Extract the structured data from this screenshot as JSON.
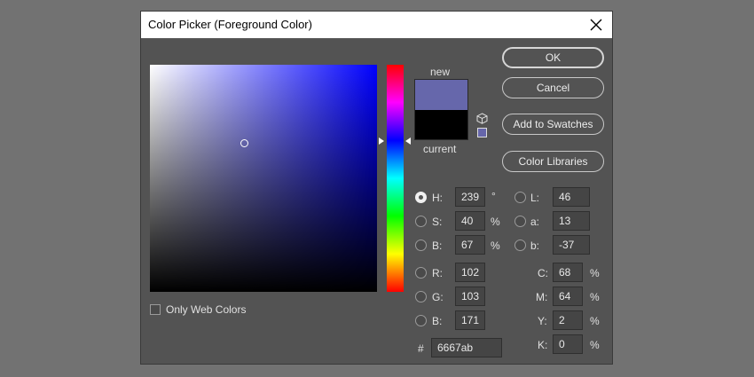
{
  "dialog": {
    "title": "Color Picker (Foreground Color)",
    "close_icon": "close-icon"
  },
  "swatch": {
    "new_label": "new",
    "current_label": "current",
    "new_color": "#6667ab",
    "current_color": "#000000",
    "cube_icon": "cube-icon"
  },
  "buttons": {
    "ok": "OK",
    "cancel": "Cancel",
    "add_to_swatches": "Add to Swatches",
    "color_libraries": "Color Libraries"
  },
  "only_web_colors": {
    "label": "Only Web Colors",
    "checked": false
  },
  "hsb": {
    "h": {
      "label": "H:",
      "value": "239",
      "unit": "°"
    },
    "s": {
      "label": "S:",
      "value": "40",
      "unit": "%"
    },
    "b": {
      "label": "B:",
      "value": "67",
      "unit": "%"
    }
  },
  "rgb": {
    "r": {
      "label": "R:",
      "value": "102"
    },
    "g": {
      "label": "G:",
      "value": "103"
    },
    "b": {
      "label": "B:",
      "value": "171"
    }
  },
  "lab": {
    "l": {
      "label": "L:",
      "value": "46"
    },
    "a": {
      "label": "a:",
      "value": "13"
    },
    "b": {
      "label": "b:",
      "value": "-37"
    }
  },
  "cmyk": {
    "c": {
      "label": "C:",
      "value": "68",
      "unit": "%"
    },
    "m": {
      "label": "M:",
      "value": "64",
      "unit": "%"
    },
    "y": {
      "label": "Y:",
      "value": "2",
      "unit": "%"
    },
    "k": {
      "label": "K:",
      "value": "0",
      "unit": "%"
    }
  },
  "hex": {
    "label": "#",
    "value": "6667ab"
  },
  "selected_mode": "H"
}
